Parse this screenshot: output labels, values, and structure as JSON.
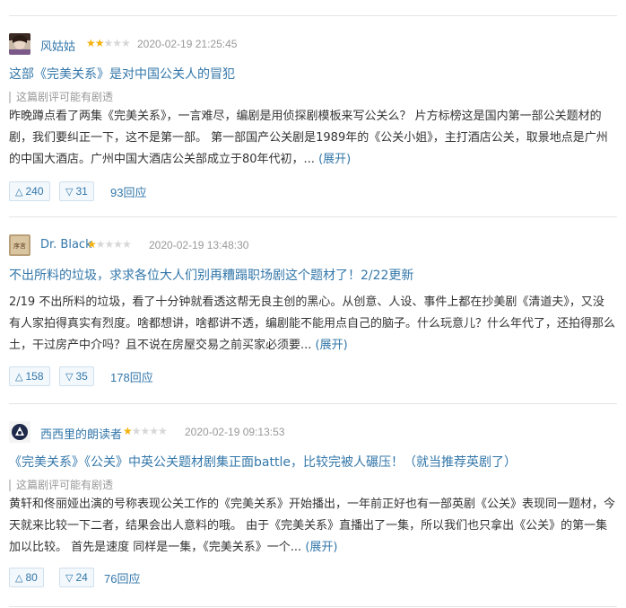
{
  "reviews": [
    {
      "author": "风姑姑",
      "rating": 2,
      "time": "2020-02-19 21:25:45",
      "title": "这部《完美关系》是对中国公关人的冒犯",
      "spoiler": "这篇剧评可能有剧透",
      "body": "昨晚蹲点看了两集《完美关系》，一言难尽，编剧是用侦探剧模板来写公关么？ 片方标榜这是国内第一部公关题材的剧，我们要纠正一下，这不是第一部。 第一部国产公关剧是1989年的《公关小姐》，主打酒店公关，取景地点是广州的中国大酒店。广州中国大酒店公关部成立于80年代初，...",
      "expand": "(展开)",
      "useful": "240",
      "useless": "31",
      "replies": "93回应"
    },
    {
      "author": "Dr. Black",
      "rating": 1,
      "time": "2020-02-19 13:48:30",
      "title": "不出所料的垃圾，求求各位大人们别再糟蹋职场剧这个题材了！2/22更新",
      "spoiler": "",
      "body": "2/19 不出所料的垃圾，看了十分钟就看透这帮无良主创的黑心。从创意、人设、事件上都在抄美剧《清道夫》，又没有人家拍得真实有烈度。啥都想讲，啥都讲不透，编剧能不能用点自己的脑子。什么玩意儿？什么年代了，还拍得那么土，干过房产中介吗？且不说在房屋交易之前买家必须要...",
      "expand": "(展开)",
      "useful": "158",
      "useless": "35",
      "replies": "178回应"
    },
    {
      "author": "西西里的朗读者",
      "rating": 1,
      "time": "2020-02-19 09:13:53",
      "title": "《完美关系》《公关》中英公关题材剧集正面battle，比较完被人碾压！（就当推荐英剧了）",
      "spoiler": "这篇剧评可能有剧透",
      "body": "黄轩和佟丽娅出演的号称表现公关工作的《完美关系》开始播出，一年前正好也有一部英剧《公关》表现同一题材，今天就来比较一下二者，结果会出人意料的哦。 由于《完美关系》直播出了一集，所以我们也只拿出《公关》的第一集加以比较。 首先是速度 同样是一集，《完美关系》一个...",
      "expand": "(展开)",
      "useful": "80",
      "useless": "24",
      "replies": "76回应"
    }
  ],
  "icons": {
    "useful": "triangle-up",
    "useless": "triangle-down",
    "star": "star"
  },
  "colors": {
    "link": "#3377aa",
    "star": "#f5b10b",
    "muted": "#999999"
  }
}
